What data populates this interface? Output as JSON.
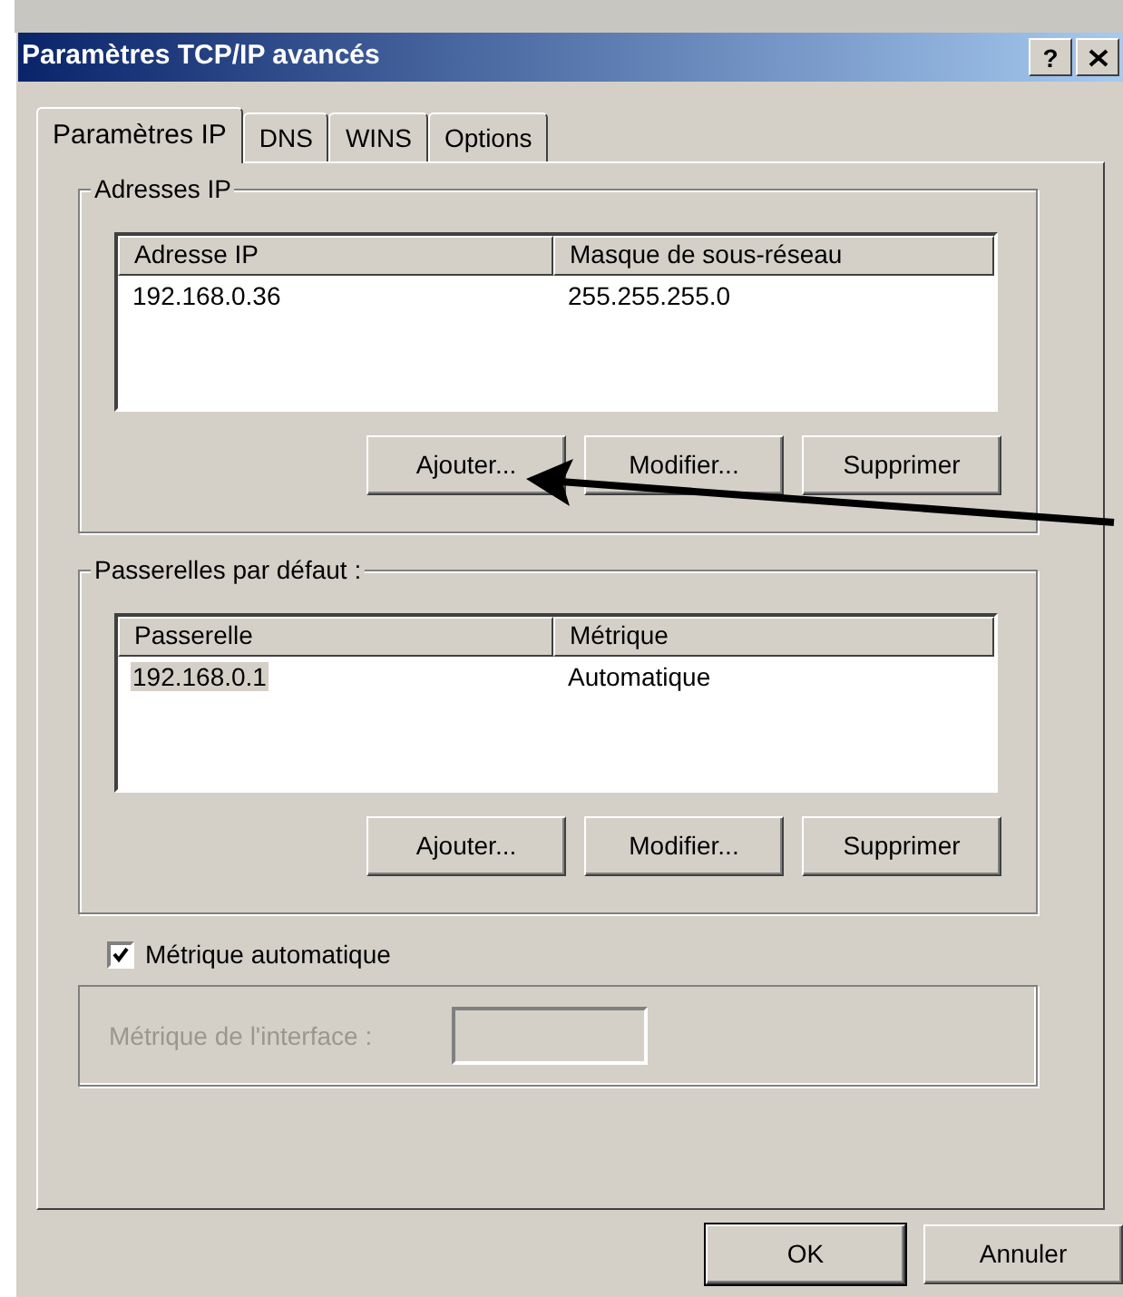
{
  "window": {
    "title": "Paramètres TCP/IP avancés",
    "help_button": "?"
  },
  "tabs": [
    {
      "label": "Paramètres IP",
      "selected": true
    },
    {
      "label": "DNS",
      "selected": false
    },
    {
      "label": "WINS",
      "selected": false
    },
    {
      "label": "Options",
      "selected": false
    }
  ],
  "ip_addresses": {
    "label": "Adresses IP",
    "columns": [
      "Adresse IP",
      "Masque de sous-réseau"
    ],
    "rows": [
      {
        "cells": [
          "192.168.0.36",
          "255.255.255.0"
        ],
        "selected": false
      }
    ],
    "buttons": [
      {
        "label": "Ajouter...",
        "disabled": false
      },
      {
        "label": "Modifier...",
        "disabled": false
      },
      {
        "label": "Supprimer",
        "disabled": false
      }
    ]
  },
  "default_gateways": {
    "label": "Passerelles par défaut :",
    "columns": [
      "Passerelle",
      "Métrique"
    ],
    "rows": [
      {
        "cells": [
          "192.168.0.1",
          "Automatique"
        ],
        "selected": true
      }
    ],
    "buttons": [
      {
        "label": "Ajouter...",
        "disabled": false
      },
      {
        "label": "Modifier...",
        "disabled": false
      },
      {
        "label": "Supprimer",
        "disabled": false
      }
    ]
  },
  "automatic_metric": {
    "label": "Métrique automatique",
    "checked": true
  },
  "interface_metric": {
    "label": "Métrique de l'interface :",
    "disabled": true
  },
  "dialog_buttons": [
    {
      "label": "OK",
      "default": true
    },
    {
      "label": "Annuler",
      "default": false
    }
  ]
}
